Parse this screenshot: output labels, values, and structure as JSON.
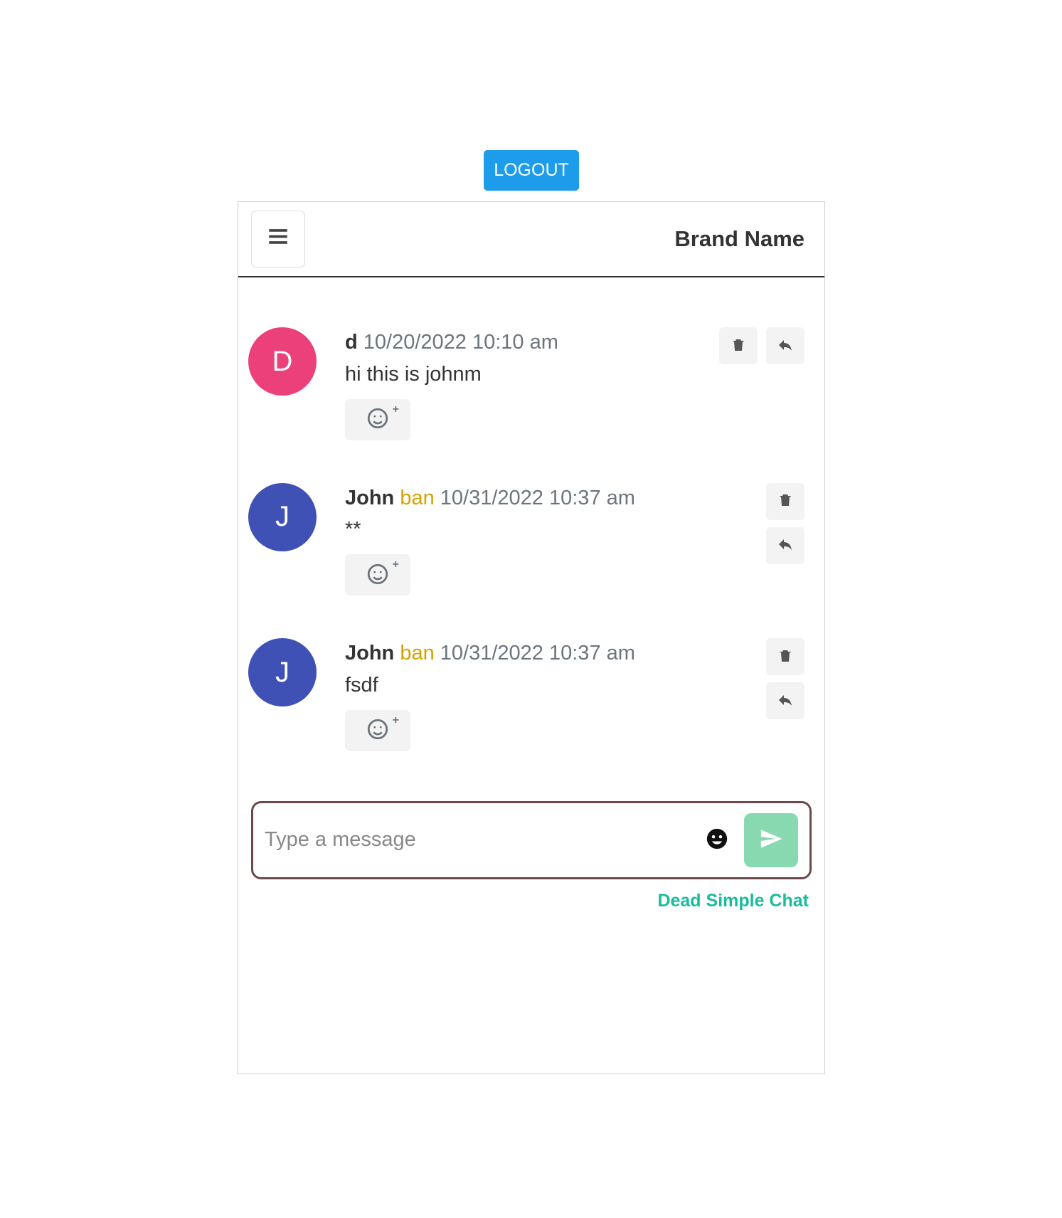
{
  "logout_label": "LOGOUT",
  "header": {
    "brand": "Brand Name"
  },
  "messages": [
    {
      "avatar_initial": "D",
      "avatar_color": "pink",
      "author": "d",
      "ban_label": "",
      "timestamp": "10/20/2022 10:10 am",
      "text": "hi this is johnm",
      "actions_layout": "row"
    },
    {
      "avatar_initial": "J",
      "avatar_color": "indigo",
      "author": "John",
      "ban_label": "ban",
      "timestamp": "10/31/2022 10:37 am",
      "text": "**",
      "actions_layout": "col"
    },
    {
      "avatar_initial": "J",
      "avatar_color": "indigo",
      "author": "John",
      "ban_label": "ban",
      "timestamp": "10/31/2022 10:37 am",
      "text": "fsdf",
      "actions_layout": "col"
    }
  ],
  "composer": {
    "placeholder": "Type a message"
  },
  "footer_brand": "Dead Simple Chat"
}
